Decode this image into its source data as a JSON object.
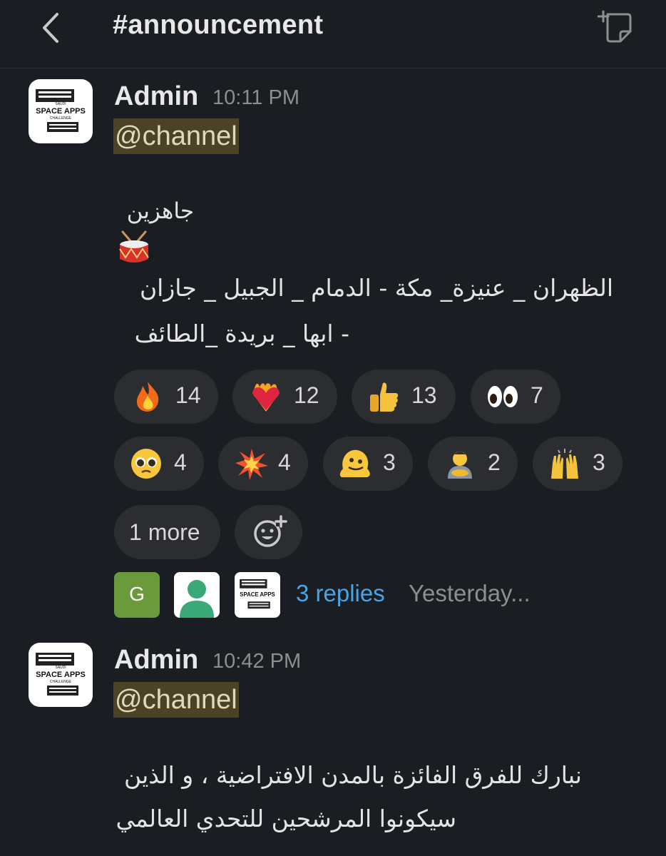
{
  "header": {
    "title": "#announcement",
    "back_icon": "chevron-left-icon",
    "compose_icon": "compose-icon"
  },
  "logo": {
    "line1": "SAUDI",
    "line2": "SPACE APPS",
    "line3": "CHALLENGE"
  },
  "messages": [
    {
      "sender": "Admin",
      "time": "10:11 PM",
      "mention": "@channel",
      "lines": [
        "جاهزين",
        "الظهران _ عنيزة_ مكة - الدمام _ الجبيل _ جازان",
        "- ابها _ بريدة _الطائف"
      ],
      "emoji": "drum",
      "reactions": [
        {
          "emoji": "fire",
          "count": "14"
        },
        {
          "emoji": "heart-on-fire",
          "count": "12"
        },
        {
          "emoji": "thumbs-up",
          "count": "13"
        },
        {
          "emoji": "eyes",
          "count": "7"
        },
        {
          "emoji": "pleading-face",
          "count": "4"
        },
        {
          "emoji": "collision",
          "count": "4"
        },
        {
          "emoji": "melting-face",
          "count": "3"
        },
        {
          "emoji": "person-bowing",
          "count": "2"
        },
        {
          "emoji": "raising-hands",
          "count": "3"
        }
      ],
      "more_label": "1 more",
      "add_reaction_icon": "add-reaction-icon",
      "thread": {
        "avatar_letter": "G",
        "avatar_colors": {
          "g": "#6b9a3c",
          "user": "#3aa877"
        },
        "replies": "3 replies",
        "last_reply": "Yesterday..."
      }
    },
    {
      "sender": "Admin",
      "time": "10:42 PM",
      "mention": "@channel",
      "lines": [
        "نبارك للفرق الفائزة بالمدن الافتراضية ، و الذين",
        "سيكونوا المرشحين للتحدي العالمي"
      ]
    }
  ],
  "colors": {
    "background": "#1a1d21",
    "mention_bg": "#4b4326",
    "link": "#4aa4e6",
    "pill": "#2b2d31"
  }
}
